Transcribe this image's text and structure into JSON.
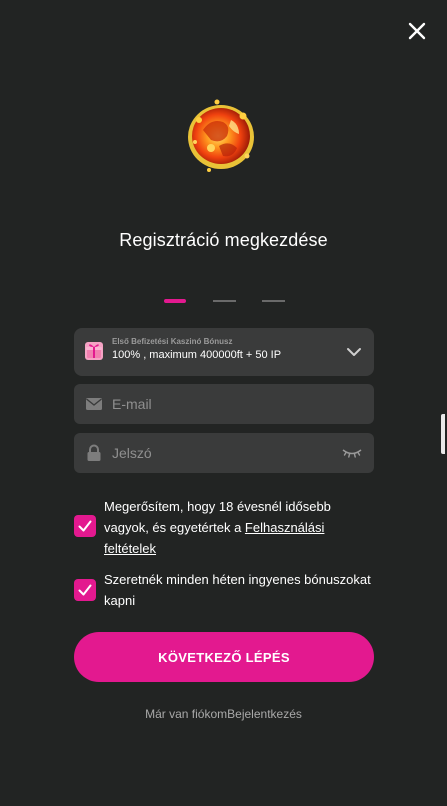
{
  "modal": {
    "title": "Regisztráció megkezdése"
  },
  "steps": {
    "count": 3,
    "active_index": 0
  },
  "bonus": {
    "caption": "Első Befizetési Kaszinó Bónusz",
    "value": "100% , maximum 400000ft + 50 IP"
  },
  "email": {
    "placeholder": "E-mail",
    "value": ""
  },
  "password": {
    "placeholder": "Jelszó",
    "value": ""
  },
  "consents": {
    "terms_text": "Megerősítem, hogy 18 évesnél idősebb vagyok, és egyetértek a ",
    "terms_link": "Felhasználási feltételek",
    "terms_checked": true,
    "newsletter_text": "Szeretnék minden héten ingyenes bónuszokat kapni",
    "newsletter_checked": true
  },
  "next_button": {
    "label": "KÖVETKEZŐ LÉPÉS"
  },
  "login": {
    "prompt": "Már van fiókom",
    "link": "Bejelentkezés"
  },
  "colors": {
    "background": "#222423",
    "accent": "#e3198f",
    "field": "#3a3b3b",
    "muted_text": "#a9a9a9"
  },
  "icons": {
    "close": "close-icon",
    "hero": "fireball-icon",
    "bonus": "gift-icon",
    "dropdown": "chevron-down-icon",
    "email": "envelope-icon",
    "password": "lock-icon",
    "reveal": "eye-closed-icon",
    "check": "checkmark-icon"
  }
}
